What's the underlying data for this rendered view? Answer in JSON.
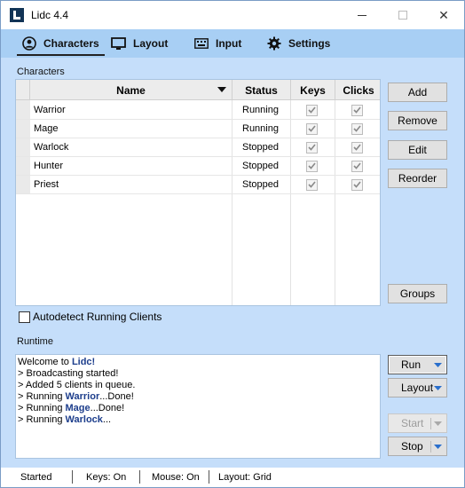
{
  "window": {
    "title": "Lidc 4.4",
    "close_glyph": "✕"
  },
  "tabs": [
    {
      "label": "Characters",
      "icon": "user-circle-icon",
      "active": true
    },
    {
      "label": "Layout",
      "icon": "monitor-icon",
      "active": false
    },
    {
      "label": "Input",
      "icon": "keyboard-icon",
      "active": false
    },
    {
      "label": "Settings",
      "icon": "gear-icon",
      "active": false
    }
  ],
  "characters": {
    "section_label": "Characters",
    "columns": [
      "Name",
      "Status",
      "Keys",
      "Clicks"
    ],
    "rows": [
      {
        "name": "Warrior",
        "status": "Running",
        "keys": true,
        "clicks": true
      },
      {
        "name": "Mage",
        "status": "Running",
        "keys": true,
        "clicks": true
      },
      {
        "name": "Warlock",
        "status": "Stopped",
        "keys": true,
        "clicks": true
      },
      {
        "name": "Hunter",
        "status": "Stopped",
        "keys": true,
        "clicks": true
      },
      {
        "name": "Priest",
        "status": "Stopped",
        "keys": true,
        "clicks": true
      }
    ],
    "buttons": {
      "add": "Add",
      "remove": "Remove",
      "edit": "Edit",
      "reorder": "Reorder",
      "groups": "Groups"
    },
    "autodetect_label": "Autodetect Running Clients",
    "autodetect_checked": false
  },
  "runtime": {
    "section_label": "Runtime",
    "log": [
      [
        {
          "t": "Welcome to "
        },
        {
          "t": "Lidc!",
          "hl": true
        }
      ],
      [
        {
          "t": "> Broadcasting started!"
        }
      ],
      [
        {
          "t": "> Added 5 clients in queue."
        }
      ],
      [
        {
          "t": "> Running "
        },
        {
          "t": "Warrior",
          "hl": true
        },
        {
          "t": "...Done!"
        }
      ],
      [
        {
          "t": "> Running "
        },
        {
          "t": "Mage",
          "hl": true
        },
        {
          "t": "...Done!"
        }
      ],
      [
        {
          "t": "> Running "
        },
        {
          "t": "Warlock",
          "hl": true
        },
        {
          "t": "..."
        }
      ]
    ],
    "buttons": {
      "run": "Run",
      "layout": "Layout",
      "start": "Start",
      "stop": "Stop"
    }
  },
  "status_bar": {
    "state": "Started",
    "keys": "Keys: On",
    "mouse": "Mouse: On",
    "layout": "Layout: Grid"
  },
  "colors": {
    "panel": "#c5defa",
    "tabbar": "#a8cff4",
    "accent": "#2a6fcc",
    "highlight_text": "#1d3e8c"
  }
}
